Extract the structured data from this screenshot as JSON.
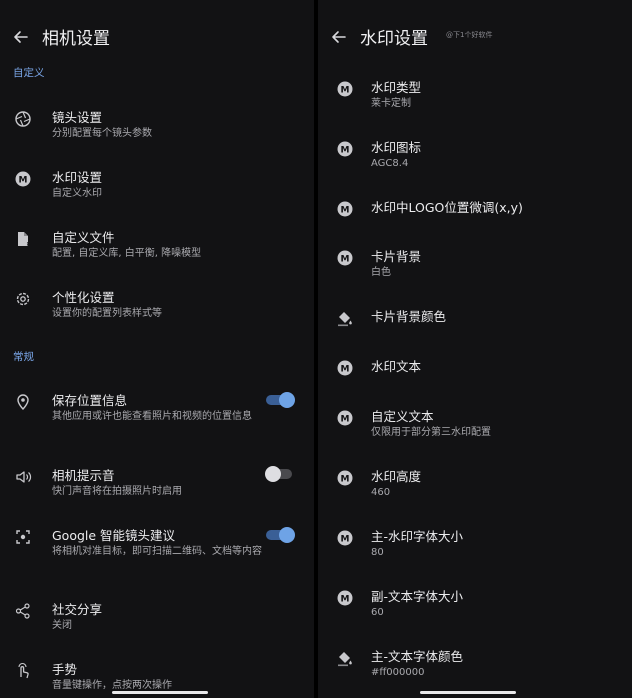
{
  "left": {
    "title": "相机设置",
    "sections": [
      {
        "label": "自定义",
        "items": [
          {
            "title": "镜头设置",
            "subtitle": "分别配置每个镜头参数",
            "icon": "aperture-icon"
          },
          {
            "title": "水印设置",
            "subtitle": "自定义水印",
            "icon": "leica-m-icon"
          },
          {
            "title": "自定义文件",
            "subtitle": "配置, 自定义库, 白平衡, 降噪模型",
            "icon": "file-icon"
          },
          {
            "title": "个性化设置",
            "subtitle": "设置你的配置列表样式等",
            "icon": "gear-icon"
          }
        ]
      },
      {
        "label": "常规",
        "items": [
          {
            "title": "保存位置信息",
            "subtitle": "其他应用或许也能查看照片和视频的位置信息",
            "icon": "location-pin-icon",
            "toggle": true
          },
          {
            "title": "相机提示音",
            "subtitle": "快门声音将在拍摄照片时启用",
            "icon": "speaker-icon",
            "toggle": false
          },
          {
            "title": "Google 智能镜头建议",
            "subtitle": "将相机对准目标，即可扫描二维码、文档等内容",
            "icon": "lens-scan-icon",
            "toggle": true
          },
          {
            "title": "社交分享",
            "subtitle": "关闭",
            "icon": "share-icon"
          },
          {
            "title": "手势",
            "subtitle": "音量键操作，点按两次操作",
            "icon": "gesture-hand-icon"
          }
        ]
      }
    ]
  },
  "right": {
    "title": "水印设置",
    "watermark_text": "@下1个好软件",
    "items": [
      {
        "title": "水印类型",
        "subtitle": "莱卡定制",
        "icon": "leica-m-icon"
      },
      {
        "title": "水印图标",
        "subtitle": "AGC8.4",
        "icon": "leica-m-icon"
      },
      {
        "title": "水印中LOGO位置微调(x,y)",
        "subtitle": "",
        "icon": "leica-m-icon"
      },
      {
        "title": "卡片背景",
        "subtitle": "白色",
        "icon": "leica-m-icon"
      },
      {
        "title": "卡片背景颜色",
        "subtitle": "",
        "icon": "paint-bucket-icon"
      },
      {
        "title": "水印文本",
        "subtitle": "",
        "icon": "leica-m-icon"
      },
      {
        "title": "自定义文本",
        "subtitle": "仅限用于部分第三水印配置",
        "icon": "leica-m-icon"
      },
      {
        "title": "水印高度",
        "subtitle": "460",
        "icon": "leica-m-icon"
      },
      {
        "title": "主-水印字体大小",
        "subtitle": "80",
        "icon": "leica-m-icon"
      },
      {
        "title": "副-文本字体大小",
        "subtitle": "60",
        "icon": "leica-m-icon"
      },
      {
        "title": "主-文本字体颜色",
        "subtitle": "#ff000000",
        "icon": "paint-bucket-icon"
      }
    ]
  },
  "colors": {
    "background": "#121214",
    "accent": "#7aa6e8",
    "toggle_on": "#6ea3e6",
    "toggle_off": "#dedee2"
  }
}
